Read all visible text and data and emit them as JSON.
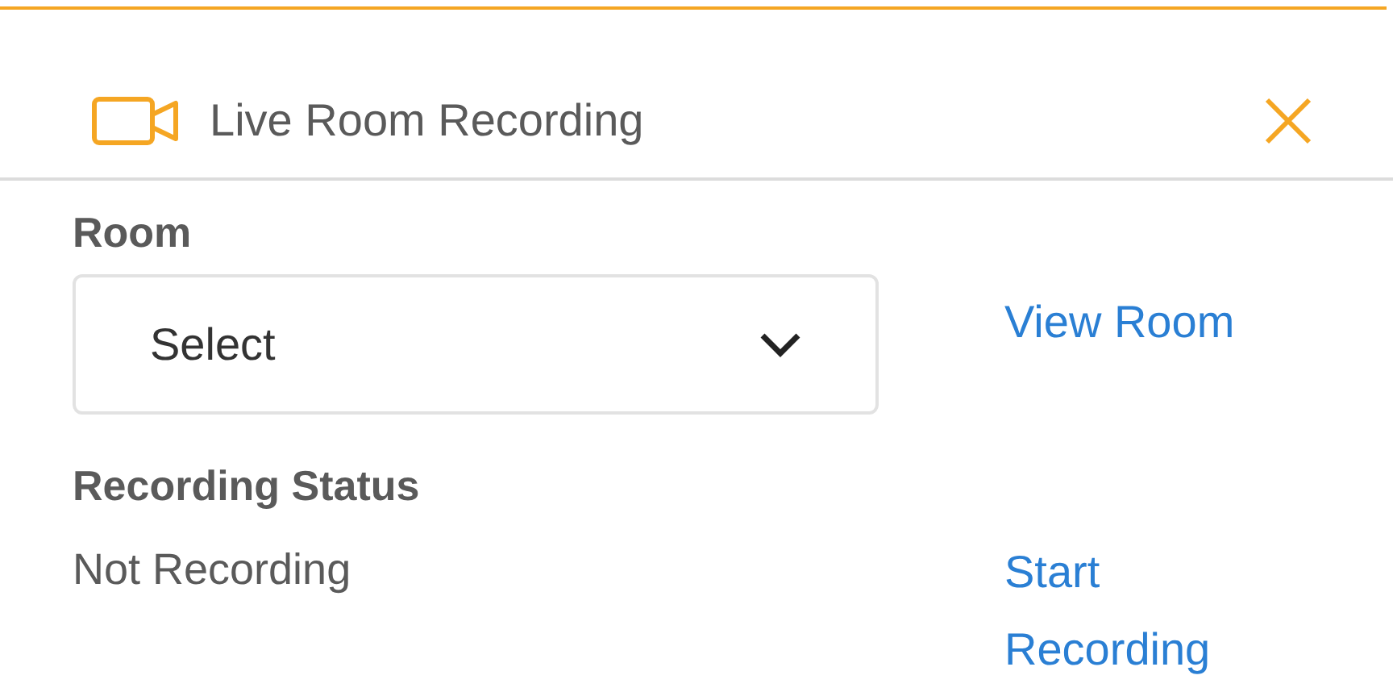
{
  "panel": {
    "title": "Live Room Recording"
  },
  "room": {
    "label": "Room",
    "select": {
      "value": "Select"
    },
    "link": "View Room"
  },
  "status": {
    "label": "Recording Status",
    "value": "Not Recording",
    "link": "Start Recording"
  }
}
